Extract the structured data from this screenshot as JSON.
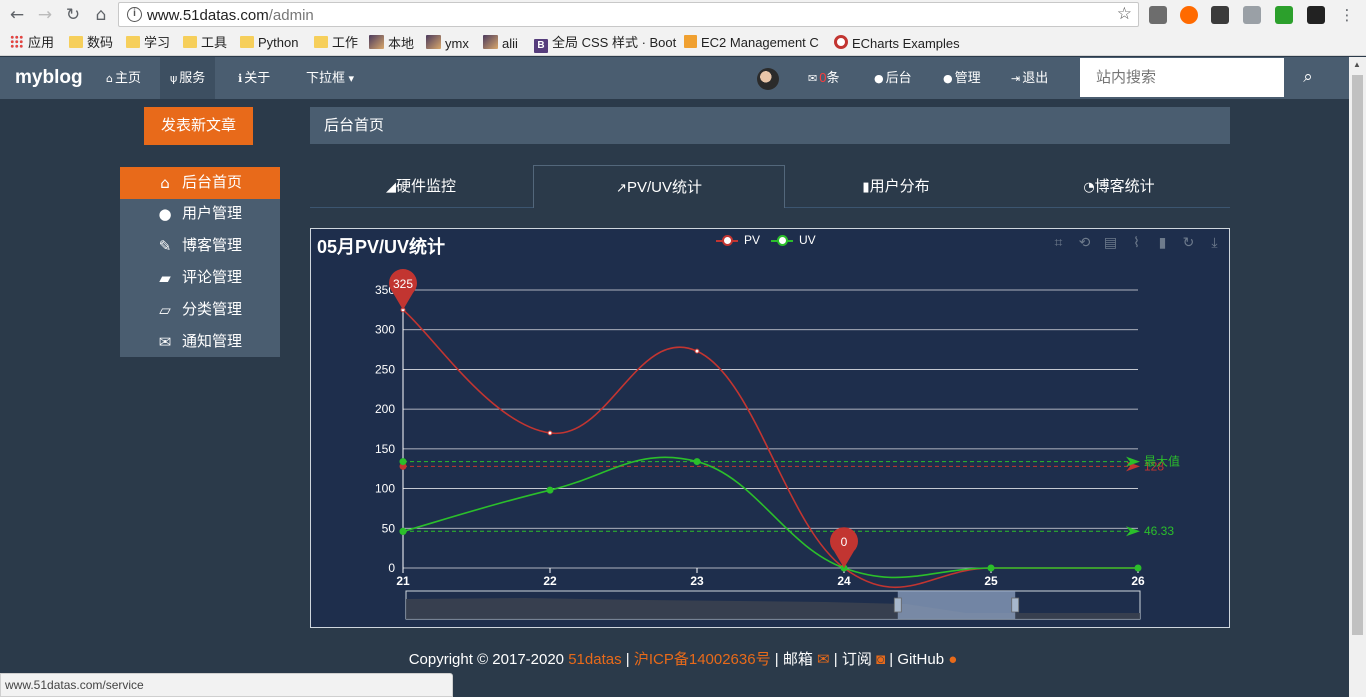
{
  "browser": {
    "url_host": "www.51datas.com",
    "url_path": "/admin",
    "bookmarks": [
      "应用",
      "数码",
      "学习",
      "工具",
      "Python",
      "工作",
      "本地",
      "ymx",
      "alii",
      "全局 CSS 样式 · Boot",
      "EC2 Management C",
      "ECharts Examples"
    ],
    "status_url": "www.51datas.com/service"
  },
  "navbar": {
    "brand": "myblog",
    "home": "主页",
    "service": "服务",
    "about": "关于",
    "dropdown": "下拉框",
    "msg_count": "0",
    "msg_unit": "条",
    "backend": "后台",
    "manage": "管理",
    "logout": "退出",
    "search_placeholder": "站内搜索"
  },
  "sidebar": {
    "new_post": "发表新文章",
    "items": [
      {
        "label": "后台首页",
        "icon": "home-icon"
      },
      {
        "label": "用户管理",
        "icon": "user-icon"
      },
      {
        "label": "博客管理",
        "icon": "pencil-icon"
      },
      {
        "label": "评论管理",
        "icon": "comment-icon"
      },
      {
        "label": "分类管理",
        "icon": "folder-icon"
      },
      {
        "label": "通知管理",
        "icon": "envelope-icon"
      }
    ]
  },
  "main": {
    "breadcrumb": "后台首页",
    "tabs": [
      {
        "label": "硬件监控",
        "icon": "area-chart-icon"
      },
      {
        "label": "PV/UV统计",
        "icon": "line-chart-icon"
      },
      {
        "label": "用户分布",
        "icon": "bar-chart-icon"
      },
      {
        "label": "博客统计",
        "icon": "pie-chart-icon"
      }
    ]
  },
  "chart_data": {
    "type": "line",
    "title": "05月PV/UV统计",
    "x": [
      "21",
      "22",
      "23",
      "24",
      "25",
      "26"
    ],
    "ylim": [
      0,
      350
    ],
    "yticks": [
      0,
      50,
      100,
      150,
      200,
      250,
      300,
      350
    ],
    "series": [
      {
        "name": "PV",
        "values": [
          325,
          170,
          273,
          0,
          0,
          0
        ],
        "color": "#c23531"
      },
      {
        "name": "UV",
        "values": [
          46,
          98,
          134,
          0,
          0,
          0
        ],
        "color": "#2bbf2b"
      }
    ],
    "markpoints": [
      {
        "series": "PV",
        "label": "325",
        "x": "21",
        "y": 325
      },
      {
        "series": "PV",
        "label": "0",
        "x": "24",
        "y": 0
      }
    ],
    "marklines": [
      {
        "series": "PV",
        "type": "average",
        "value": 128,
        "label": "128"
      },
      {
        "series": "UV",
        "type": "max",
        "value": 134,
        "label": "最大值"
      },
      {
        "series": "UV",
        "type": "average",
        "value": 46.33,
        "label": "46.33"
      }
    ],
    "grid": true,
    "legend": "top-center",
    "datazoom": {
      "start": 0.67,
      "end": 0.83
    }
  },
  "footer": {
    "copyright": "Copyright © 2017-2020",
    "org": "51datas",
    "sep1": "|",
    "icp": "沪ICP备14002636号",
    "sep2": "|",
    "mail": "邮箱",
    "sep3": "|",
    "subscribe": "订阅",
    "sep4": "|",
    "github": "GitHub"
  }
}
